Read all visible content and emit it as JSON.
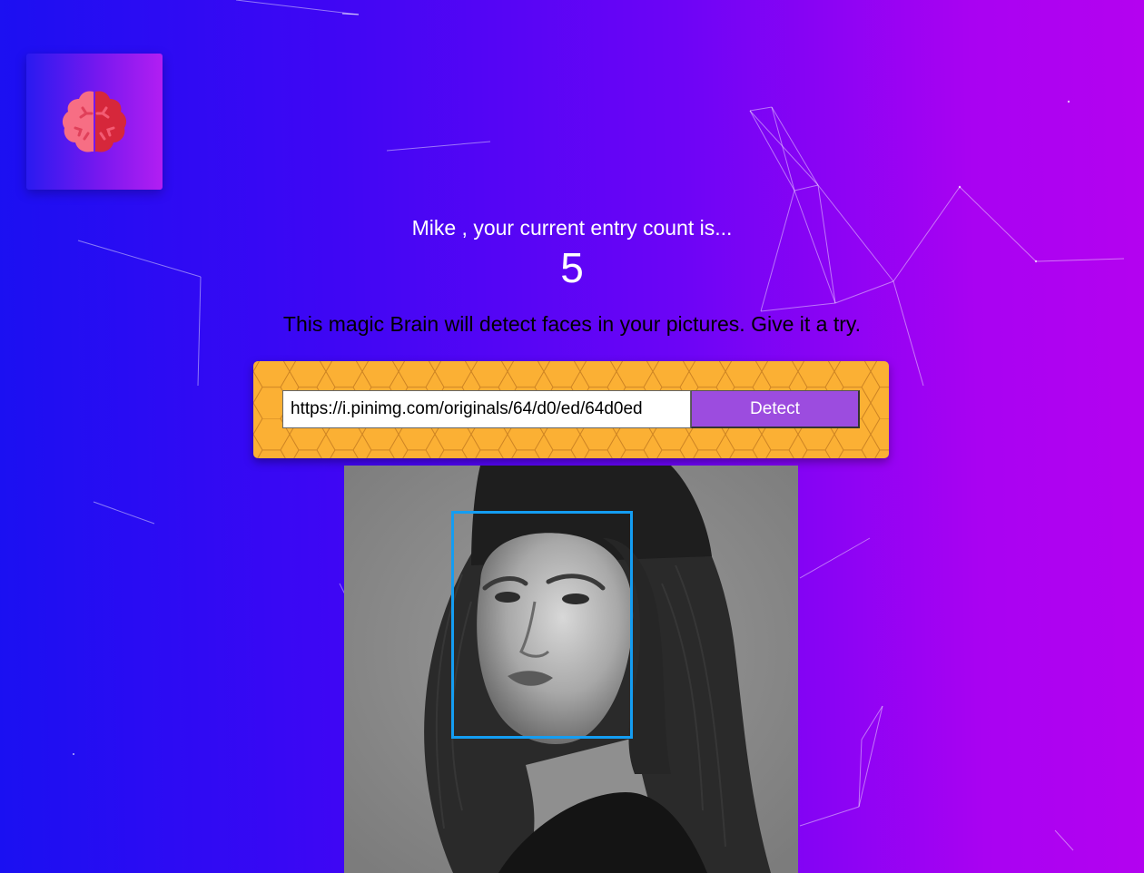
{
  "logo": {
    "icon": "brain-icon",
    "colors": {
      "left": "#f76e84",
      "right": "#d6273b"
    }
  },
  "rank": {
    "entry_text": "Mike , your current entry count is...",
    "count": "5"
  },
  "tagline": "This magic Brain will detect faces in your pictures. Give it a try.",
  "form": {
    "url_value": "https://i.pinimg.com/originals/64/d0/ed/64d0ed",
    "detect_label": "Detect"
  },
  "image": {
    "subject": "black-and-white portrait photo",
    "has_face_box": true
  },
  "colors": {
    "panel": "#fbb034",
    "button": "#9c4cdf",
    "face_box": "#149df2",
    "gradient_start": "#1a10f2",
    "gradient_end": "#b402f0"
  }
}
